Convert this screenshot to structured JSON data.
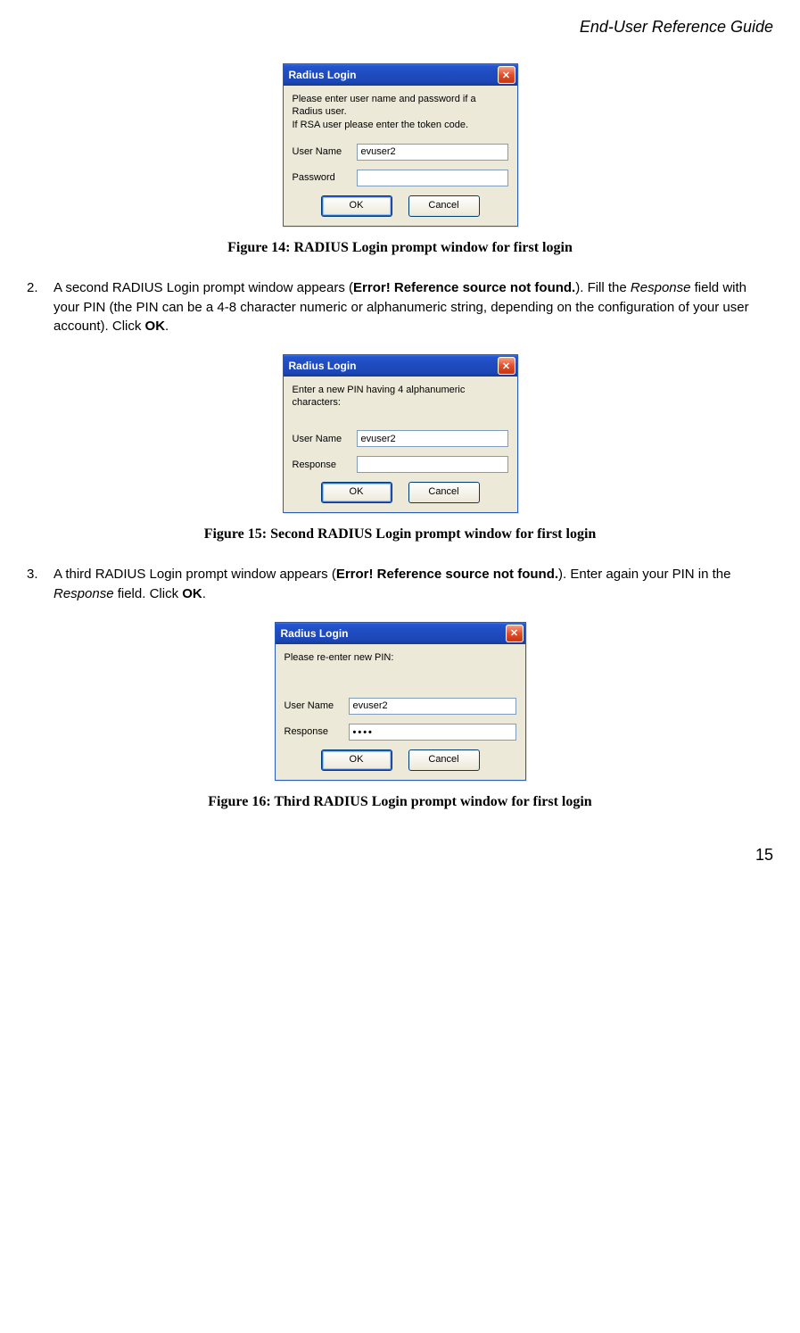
{
  "header": "End-User Reference Guide",
  "pageNumber": "15",
  "dialogs": {
    "d1": {
      "title": "Radius Login",
      "instructionLine1": "Please enter user name and password if a Radius user.",
      "instructionLine2": "If RSA user please enter the token code.",
      "userLabel": "User Name",
      "userValue": "evuser2",
      "passLabel": "Password",
      "passValue": "",
      "ok": "OK",
      "cancel": "Cancel"
    },
    "d2": {
      "title": "Radius Login",
      "instruction": "Enter a new PIN having 4 alphanumeric characters:",
      "userLabel": "User Name",
      "userValue": "evuser2",
      "respLabel": "Response",
      "respValue": "",
      "ok": "OK",
      "cancel": "Cancel"
    },
    "d3": {
      "title": "Radius Login",
      "instruction": "Please re-enter new PIN:",
      "userLabel": "User Name",
      "userValue": "evuser2",
      "respLabel": "Response",
      "respValue": "••••",
      "ok": "OK",
      "cancel": "Cancel"
    }
  },
  "captions": {
    "c1": "Figure 14:  RADIUS Login prompt window for first login",
    "c2": "Figure 15:  Second RADIUS Login prompt window for first login",
    "c3": "Figure 16:  Third RADIUS Login prompt window for first login"
  },
  "paras": {
    "p2": {
      "num": "2.",
      "t1": "A second RADIUS Login prompt window appears (",
      "err": "Error! Reference source not found.",
      "t2": "). Fill the ",
      "resp": "Response",
      "t3": " field with your PIN (the PIN can be a 4-8 character numeric or alphanumeric string, depending on the configuration of your user account). Click ",
      "ok": "OK",
      "t4": "."
    },
    "p3": {
      "num": "3.",
      "t1": "A third RADIUS Login prompt window appears (",
      "err": "Error! Reference source not found.",
      "t2": "). Enter again your PIN in the ",
      "resp": "Response",
      "t3": " field. Click ",
      "ok": "OK",
      "t4": "."
    }
  }
}
